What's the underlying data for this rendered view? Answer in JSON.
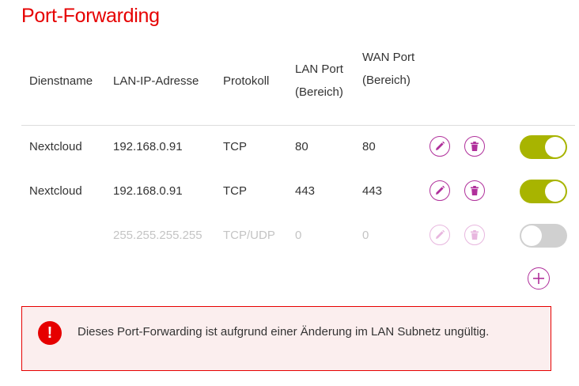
{
  "page": {
    "title": "Port-Forwarding"
  },
  "table": {
    "headers": {
      "service": "Dienstname",
      "lan_ip": "LAN-IP-Adresse",
      "protocol": "Protokoll",
      "lan_port": "LAN Port (Bereich)",
      "wan_port": "WAN Port (Bereich)"
    },
    "rows": [
      {
        "service": "Nextcloud",
        "ip": "192.168.0.91",
        "protocol": "TCP",
        "lan_port": "80",
        "wan_port": "80",
        "enabled": true
      },
      {
        "service": "Nextcloud",
        "ip": "192.168.0.91",
        "protocol": "TCP",
        "lan_port": "443",
        "wan_port": "443",
        "enabled": true
      },
      {
        "service": "",
        "ip": "255.255.255.255",
        "protocol": "TCP/UDP",
        "lan_port": "0",
        "wan_port": "0",
        "enabled": false
      }
    ]
  },
  "alert": {
    "icon": "exclamation-icon",
    "text": "Dieses Port-Forwarding ist aufgrund einer Änderung im LAN Subnetz ungültig."
  },
  "icons": {
    "edit": "pencil-icon",
    "delete": "trash-icon",
    "add": "plus-icon"
  },
  "colors": {
    "title": "#e60000",
    "accent": "#b0309b",
    "toggle_on": "#a8b400",
    "toggle_off": "#d0d0d0",
    "alert_bg": "#fbeeee",
    "alert_border": "#e60000"
  }
}
